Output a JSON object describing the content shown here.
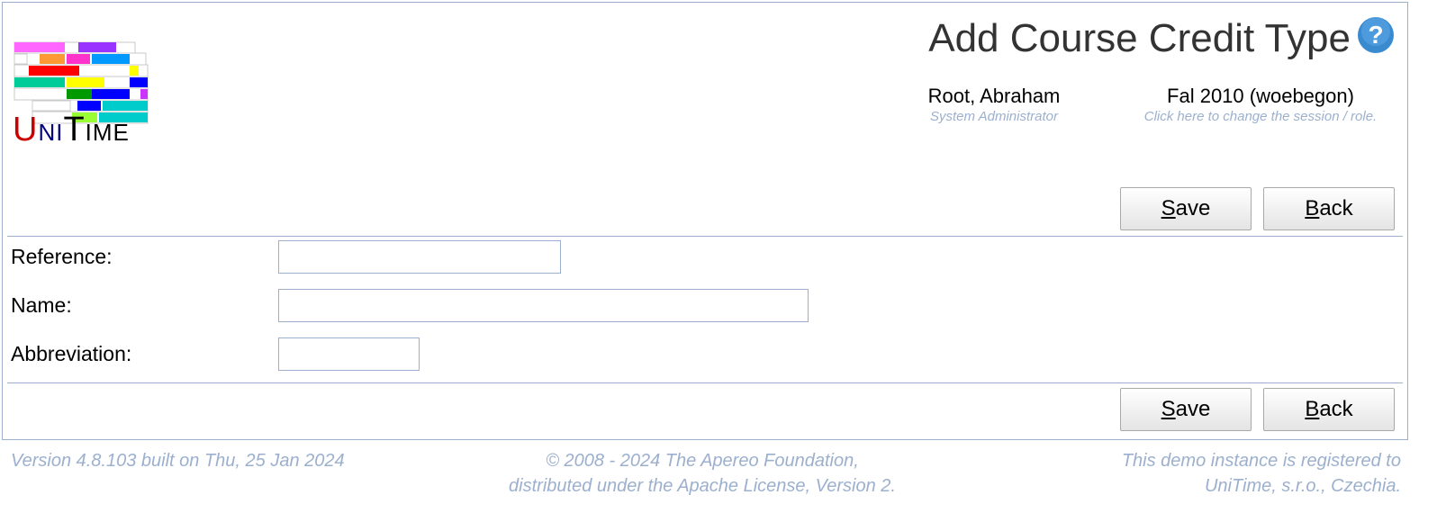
{
  "logo": {
    "u": "U",
    "n": "NI",
    "t": "T",
    "m": "IME"
  },
  "header": {
    "title": "Add Course Credit Type",
    "help_icon": "help-question-icon",
    "user_name": "Root, Abraham",
    "user_role": "System Administrator",
    "session": "Fal 2010 (woebegon)",
    "session_hint": "Click here to change the session / role."
  },
  "buttons": {
    "save_first": "S",
    "save_rest": "ave",
    "back_first": "B",
    "back_rest": "ack"
  },
  "form": {
    "reference_label": "Reference:",
    "reference_value": "",
    "name_label": "Name:",
    "name_value": "",
    "abbreviation_label": "Abbreviation:",
    "abbreviation_value": ""
  },
  "footer": {
    "version": "Version 4.8.103 built on Thu, 25 Jan 2024",
    "copyright_line1": "© 2008 - 2024 The Apereo Foundation,",
    "copyright_line2": "distributed under the Apache License, Version 2.",
    "registered_line1": "This demo instance is registered to",
    "registered_line2": "UniTime, s.r.o., Czechia."
  },
  "colors": {
    "border": "#9cb0ce",
    "muted_text": "#9cb0ce",
    "title_text": "#333333"
  }
}
